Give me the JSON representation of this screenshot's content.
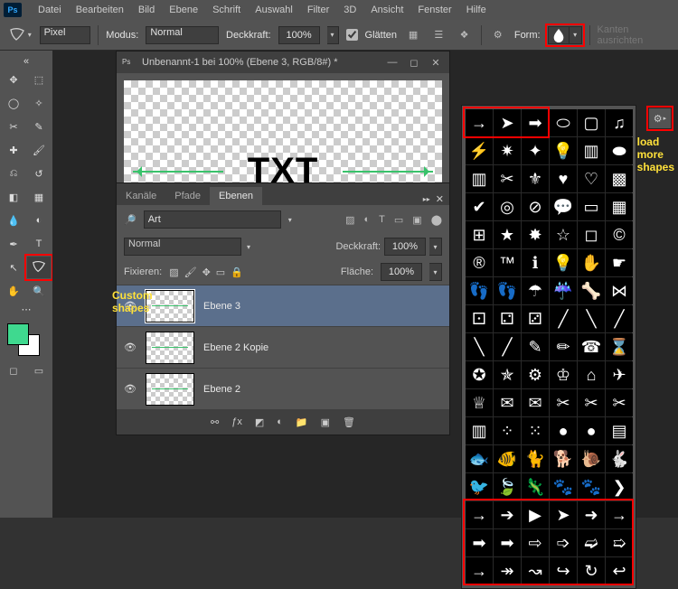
{
  "menu": {
    "items": [
      "Datei",
      "Bearbeiten",
      "Bild",
      "Ebene",
      "Schrift",
      "Auswahl",
      "Filter",
      "3D",
      "Ansicht",
      "Fenster",
      "Hilfe"
    ]
  },
  "optionbar": {
    "unit": "Pixel",
    "mode_label": "Modus:",
    "mode_value": "Normal",
    "opacity_label": "Deckkraft:",
    "opacity_value": "100%",
    "smooth_label": "Glätten",
    "form_label": "Form:",
    "edges_label": "Kanten ausrichten"
  },
  "document": {
    "title": "Unbenannt-1 bei 100% (Ebene 3, RGB/8#) *",
    "canvas_text": "TXT"
  },
  "layers_panel": {
    "tabs": [
      "Kanäle",
      "Pfade",
      "Ebenen"
    ],
    "active_tab": 2,
    "search_placeholder": "Art",
    "blend_mode": "Normal",
    "opacity_label": "Deckkraft:",
    "opacity_value": "100%",
    "lock_label": "Fixieren:",
    "fill_label": "Fläche:",
    "fill_value": "100%",
    "layers": [
      {
        "name": "Ebene 3",
        "selected": true
      },
      {
        "name": "Ebene 2 Kopie",
        "selected": false
      },
      {
        "name": "Ebene 2",
        "selected": false
      }
    ]
  },
  "callouts": {
    "custom": "Custom\nshapes",
    "load": "load\nmore\nshapes"
  },
  "shapes": {
    "highlight_top_count": 3,
    "highlight_bottom_rows": 3,
    "icons": [
      "arrow-thin",
      "arrow-head",
      "arrow-block",
      "banner",
      "frame",
      "music-note",
      "bolt",
      "burst",
      "sparkle",
      "bulb-sm",
      "tile",
      "blob",
      "stamp",
      "scissors",
      "fleur",
      "heart-solid",
      "heart-wire",
      "checker",
      "check",
      "target",
      "no",
      "speech",
      "speech-rect",
      "grid",
      "grid4",
      "star",
      "splat",
      "star-outline",
      "square-outline",
      "copyright",
      "registered",
      "tm",
      "info",
      "bulb",
      "hand",
      "hand2",
      "foot",
      "foot2",
      "umbrella",
      "rain",
      "bone",
      "bow",
      "puzzle",
      "puzzle2",
      "puzzle3",
      "slash",
      "slash2",
      "slash3",
      "slash4",
      "slash5",
      "pen",
      "pencil",
      "phone",
      "hourglass",
      "badge",
      "sheriff",
      "cog",
      "crown",
      "house",
      "plane",
      "crown2",
      "envelope",
      "envelope-open",
      "scissors2",
      "scissors3",
      "scissors4",
      "stamp2",
      "dots",
      "dots2",
      "seal",
      "circle",
      "flag-us",
      "fish",
      "fish2",
      "cat",
      "dog",
      "snail",
      "rabbit",
      "bird",
      "leaf",
      "gator",
      "paw",
      "paw2",
      "chev",
      "arr1",
      "arr2",
      "arr3",
      "arr4",
      "arr5",
      "arr6",
      "arr7",
      "arr8",
      "arr9",
      "arr10",
      "arr11",
      "arr12",
      "arr13",
      "arr14",
      "curve1",
      "curve2",
      "curve3",
      "curve4"
    ]
  }
}
